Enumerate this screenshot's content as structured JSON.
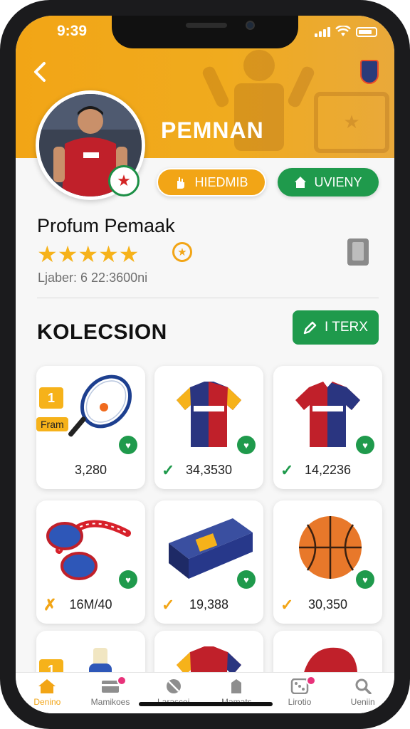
{
  "status_bar": {
    "time": "9:39"
  },
  "header": {
    "player_name": "PEMNAN",
    "btn_orange_label": "HIEDMIB",
    "btn_green_label": "UVIENY"
  },
  "profile": {
    "name": "Profum Pemaak",
    "stars": "★★★★★",
    "stat_line": "Ljaber: 6 22:3600ni"
  },
  "collection": {
    "title": "KOLECSION",
    "filter_label": "I TERX",
    "items": [
      {
        "price": "3,280",
        "status": "",
        "rank": "1",
        "tag": "Fram"
      },
      {
        "price": "34,3530",
        "status": "✓"
      },
      {
        "price": "14,2236",
        "status": "✓"
      },
      {
        "price": "16M/40",
        "status": "✗"
      },
      {
        "price": "19,388",
        "status": "✓"
      },
      {
        "price": "30,350",
        "status": "✓"
      },
      {
        "rank": "1"
      }
    ]
  },
  "nav": [
    {
      "label": "Denino"
    },
    {
      "label": "Mamikoes"
    },
    {
      "label": "Larascei"
    },
    {
      "label": "Mamats"
    },
    {
      "label": "Lirotio"
    },
    {
      "label": "Ueniin"
    }
  ],
  "colors": {
    "accent": "#f2a516",
    "green": "#1f9a4c",
    "badge": "#e8327a"
  }
}
